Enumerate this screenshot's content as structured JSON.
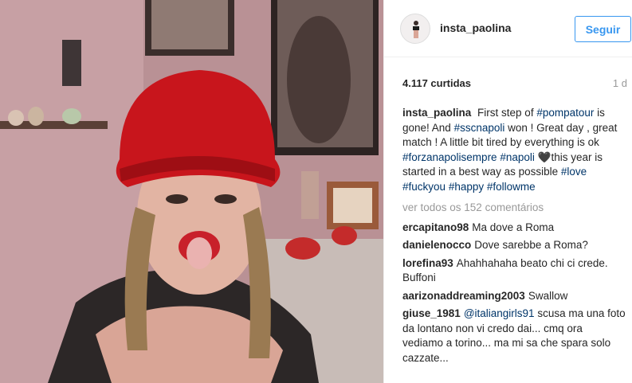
{
  "header": {
    "username": "insta_paolina",
    "follow_label": "Seguir"
  },
  "stats": {
    "likes": "4.117 curtidas",
    "time": "1 d"
  },
  "caption": {
    "username": "insta_paolina",
    "parts": [
      {
        "t": "First step of "
      },
      {
        "t": "#pompatour",
        "tag": true
      },
      {
        "t": " is gone! And "
      },
      {
        "t": "#sscnapoli",
        "tag": true
      },
      {
        "t": " won ! Great day , great match ! A little bit tired by everything is ok "
      },
      {
        "t": "#forzanapolisempre",
        "tag": true
      },
      {
        "t": " "
      },
      {
        "t": "#napoli",
        "tag": true
      },
      {
        "t": " 🖤this year is started in a best way as possible "
      },
      {
        "t": "#love",
        "tag": true
      },
      {
        "t": " "
      },
      {
        "t": "#fuckyou",
        "tag": true
      },
      {
        "t": " "
      },
      {
        "t": "#happy",
        "tag": true
      },
      {
        "t": " "
      },
      {
        "t": "#followme",
        "tag": true
      }
    ]
  },
  "view_all": "ver todos os 152 comentários",
  "comments": [
    {
      "user": "ercapitano98",
      "parts": [
        {
          "t": "Ma dove a Roma"
        }
      ]
    },
    {
      "user": "danielenocco",
      "parts": [
        {
          "t": "Dove sarebbe a Roma?"
        }
      ]
    },
    {
      "user": "lorefina93",
      "parts": [
        {
          "t": "Ahahhahaha beato chi ci crede. Buffoni"
        }
      ]
    },
    {
      "user": "aarizonaddreaming2003",
      "parts": [
        {
          "t": "Swallow"
        }
      ]
    },
    {
      "user": "giuse_1981",
      "parts": [
        {
          "t": "@italiangirls91",
          "tag": true
        },
        {
          "t": " scusa ma una foto da lontano non vi credo dai... cmq ora vediamo a torino... ma mi sa che spara solo cazzate..."
        }
      ]
    }
  ],
  "colors": {
    "hashtag": "#003569",
    "follow_blue": "#3897f0",
    "muted": "#999999"
  }
}
